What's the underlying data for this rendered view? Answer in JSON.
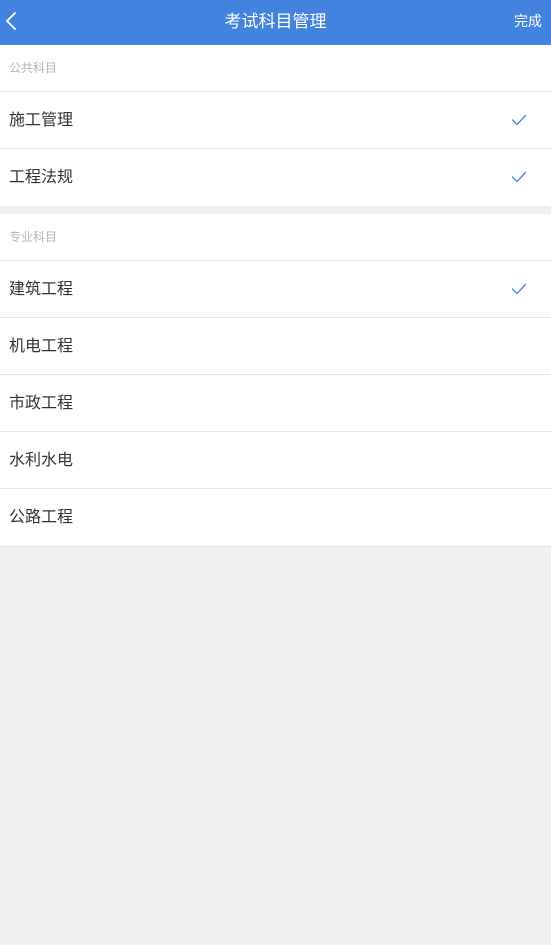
{
  "header": {
    "title": "考试科目管理",
    "done_label": "完成"
  },
  "groups": [
    {
      "title": "公共科目",
      "items": [
        {
          "label": "施工管理",
          "selected": true
        },
        {
          "label": "工程法规",
          "selected": true
        }
      ]
    },
    {
      "title": "专业科目",
      "items": [
        {
          "label": "建筑工程",
          "selected": true
        },
        {
          "label": "机电工程",
          "selected": false
        },
        {
          "label": "市政工程",
          "selected": false
        },
        {
          "label": "水利水电",
          "selected": false
        },
        {
          "label": "公路工程",
          "selected": false
        }
      ]
    }
  ],
  "colors": {
    "accent": "#4382de",
    "check": "#4a86d6",
    "background": "#efefef"
  },
  "icons": {
    "back": "chevron-left-icon",
    "check": "checkmark-icon"
  }
}
